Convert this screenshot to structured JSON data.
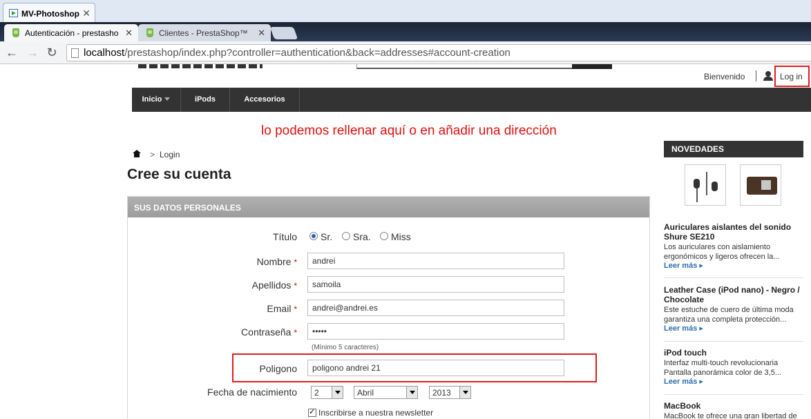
{
  "window": {
    "title": "MV-Photoshop",
    "close": "✕"
  },
  "tabs": [
    {
      "label": "Autenticación - prestasho",
      "close": "✕"
    },
    {
      "label": "Clientes - PrestaShop™",
      "close": "✕"
    }
  ],
  "nav": {
    "back": "←",
    "forward": "→",
    "reload": "↻"
  },
  "url": {
    "host": "localhost",
    "path": "/prestashop/index.php?controller=authentication&back=addresses#account-creation"
  },
  "header": {
    "welcome": "Bienvenido",
    "login": "Log in"
  },
  "menu": [
    {
      "label": "Inicio"
    },
    {
      "label": "iPods"
    },
    {
      "label": "Accesorios"
    }
  ],
  "annotation": "lo podemos rellenar aquí o en añadir una dirección",
  "breadcrumb": {
    "sep": ">",
    "current": "Login"
  },
  "page_title": "Cree su cuenta",
  "form": {
    "section_title": "SUS DATOS PERSONALES",
    "title_label": "Título",
    "title_options": [
      "Sr.",
      "Sra.",
      "Miss"
    ],
    "required_mark": "*",
    "firstname_label": "Nombre",
    "firstname_value": "andrei",
    "lastname_label": "Apellidos",
    "lastname_value": "samoila",
    "email_label": "Email",
    "email_value": "andrei@andrei.es",
    "password_label": "Contraseña",
    "password_value": "•••••",
    "password_hint": "(Mínimo 5 caracteres)",
    "poligono_label": "Poligono",
    "poligono_value": "poligono andrei 21",
    "birthdate_label": "Fecha de nacimiento",
    "birth_day": "2",
    "birth_month": "Abril",
    "birth_year": "2013",
    "newsletter_label": "Inscribirse a nuestra newsletter"
  },
  "sidebar": {
    "title": "NOVEDADES",
    "products": [
      {
        "title": "Auriculares aislantes del sonido Shure SE210",
        "desc": "Los auriculares con aislamiento ergonómicos y ligeros ofrecen la...",
        "more": "Leer más ▸"
      },
      {
        "title": "Leather Case (iPod nano) - Negro / Chocolate",
        "desc": "Este estuche de cuero de última moda garantiza una completa protección...",
        "more": "Leer más ▸"
      },
      {
        "title": "iPod touch",
        "desc": "Interfaz multi-touch revolucionaria Pantalla panorámica color de 3,5...",
        "more": "Leer más ▸"
      },
      {
        "title": "MacBook",
        "desc": "MacBook te ofrece una gran libertad de"
      }
    ]
  }
}
